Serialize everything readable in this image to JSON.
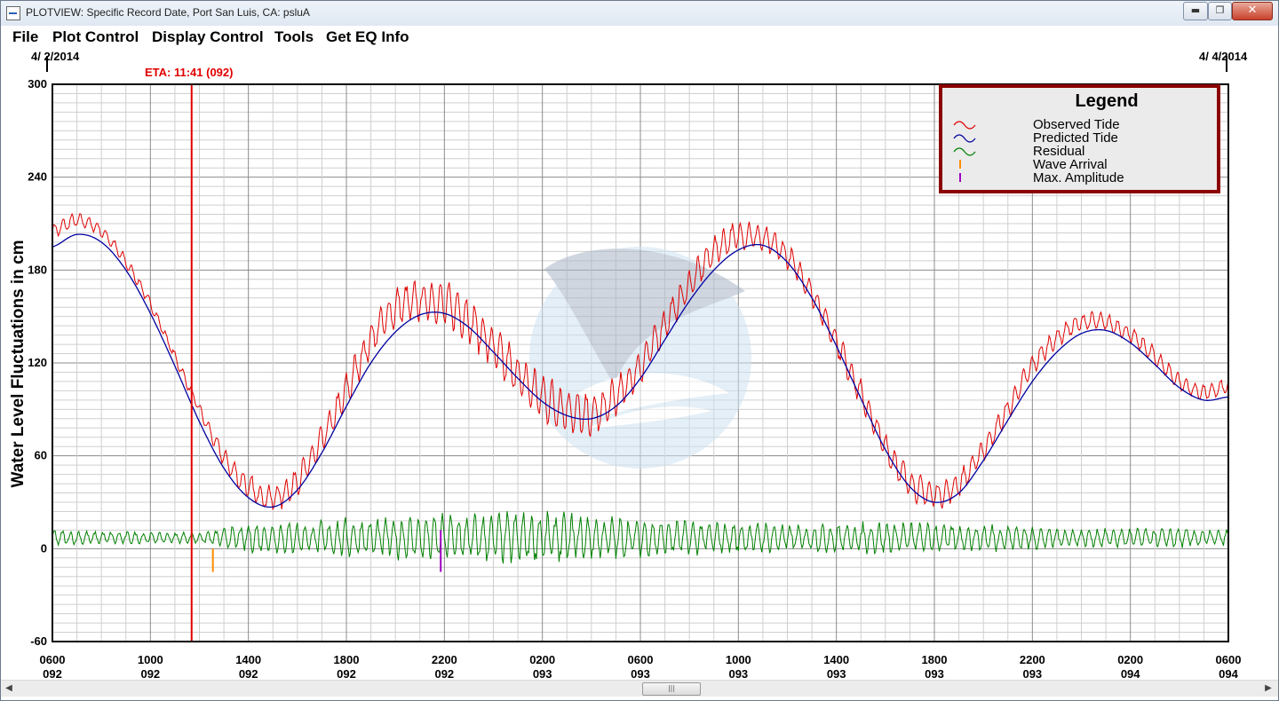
{
  "window": {
    "title": "PLOTVIEW: Specific Record Date, Port San Luis, CA: psluA",
    "minimize_label": "▬",
    "maximize_label": "❐",
    "close_label": "✕"
  },
  "menu": {
    "items": [
      "File",
      "Plot Control",
      "Display Control",
      "Tools",
      "Get EQ Info"
    ]
  },
  "plot": {
    "date_start": "4/ 2/2014",
    "date_end": "4/ 4/2014",
    "eta_label": "ETA: 11:41 (092)",
    "legend_title": "Legend",
    "watermark_icon": "noaa-bird-logo",
    "colors": {
      "observed": "#e00000",
      "predicted": "#0000a0",
      "residual": "#008000",
      "wave_arrival": "#ff8c00",
      "max_amplitude": "#a000c0",
      "eta_line": "#e00000",
      "legend_border": "#8b0000"
    }
  },
  "chart_data": {
    "type": "line",
    "title": "",
    "ylabel": "Water Level Fluctuations in cm",
    "xlabel": "",
    "ylim": [
      -60,
      300
    ],
    "yticks": [
      -60,
      0,
      60,
      120,
      180,
      240,
      300
    ],
    "xlim_hours": [
      0,
      48
    ],
    "xtick_labels": [
      [
        "0600",
        "092"
      ],
      [
        "1000",
        "092"
      ],
      [
        "1400",
        "092"
      ],
      [
        "1800",
        "092"
      ],
      [
        "2200",
        "092"
      ],
      [
        "0200",
        "093"
      ],
      [
        "0600",
        "093"
      ],
      [
        "1000",
        "093"
      ],
      [
        "1400",
        "093"
      ],
      [
        "1800",
        "093"
      ],
      [
        "2200",
        "093"
      ],
      [
        "0200",
        "094"
      ],
      [
        "0600",
        "094"
      ]
    ],
    "grid": true,
    "legend_position": "top-right",
    "legend": [
      "Observed Tide",
      "Predicted Tide",
      "Residual",
      "Wave Arrival",
      "Max. Amplitude"
    ],
    "series": [
      {
        "name": "Predicted Tide",
        "hours": [
          0,
          1,
          2,
          3,
          4,
          5,
          6,
          7,
          8,
          9,
          10,
          11,
          12,
          13,
          14,
          15,
          16,
          17,
          18,
          19,
          20,
          21,
          22,
          23,
          24,
          25,
          26,
          27,
          28,
          29,
          30,
          31,
          32,
          33,
          34,
          35,
          36,
          37,
          38,
          39,
          40,
          41,
          42,
          43,
          44,
          45,
          46,
          47,
          48
        ],
        "values": [
          195,
          203,
          198,
          180,
          152,
          118,
          82,
          52,
          33,
          27,
          38,
          62,
          92,
          120,
          140,
          151,
          152,
          143,
          127,
          110,
          95,
          86,
          84,
          92,
          110,
          135,
          160,
          180,
          193,
          196,
          185,
          162,
          131,
          97,
          64,
          40,
          30,
          36,
          57,
          83,
          108,
          127,
          139,
          141,
          133,
          119,
          104,
          96,
          98
        ]
      },
      {
        "name": "Observed Tide",
        "hours": [
          0,
          1,
          2,
          3,
          4,
          5,
          6,
          7,
          8,
          9,
          10,
          11,
          12,
          13,
          14,
          15,
          16,
          17,
          18,
          19,
          20,
          21,
          22,
          23,
          24,
          25,
          26,
          27,
          28,
          29,
          30,
          31,
          32,
          33,
          34,
          35,
          36,
          37,
          38,
          39,
          40,
          41,
          42,
          43,
          44,
          45,
          46,
          47,
          48
        ],
        "values": [
          205,
          212,
          205,
          185,
          158,
          124,
          90,
          59,
          40,
          33,
          44,
          70,
          102,
          135,
          155,
          160,
          158,
          148,
          130,
          112,
          98,
          90,
          86,
          98,
          118,
          145,
          170,
          192,
          202,
          200,
          189,
          165,
          134,
          100,
          66,
          43,
          35,
          42,
          64,
          90,
          118,
          136,
          146,
          146,
          138,
          124,
          108,
          101,
          105
        ]
      },
      {
        "name": "Residual",
        "hours": [
          0,
          1,
          2,
          3,
          4,
          5,
          6,
          7,
          8,
          9,
          10,
          11,
          12,
          13,
          14,
          15,
          16,
          17,
          18,
          19,
          20,
          21,
          22,
          23,
          24,
          25,
          26,
          27,
          28,
          29,
          30,
          31,
          32,
          33,
          34,
          35,
          36,
          37,
          38,
          39,
          40,
          41,
          42,
          43,
          44,
          45,
          46,
          47,
          48
        ],
        "amplitude": [
          8,
          7,
          6,
          6,
          5,
          5,
          6,
          9,
          13,
          14,
          15,
          16,
          18,
          18,
          20,
          20,
          22,
          23,
          23,
          24,
          24,
          23,
          22,
          20,
          18,
          17,
          16,
          15,
          15,
          14,
          13,
          13,
          14,
          15,
          15,
          15,
          14,
          13,
          13,
          12,
          11,
          10,
          9,
          9,
          9,
          10,
          9,
          8,
          8
        ],
        "baseline": 7
      }
    ],
    "markers": {
      "eta_hour": 5.683,
      "wave_arrival_hour": 6.55,
      "wave_arrival_value": -15,
      "max_amplitude_hour": 15.85,
      "max_amplitude_value": -15
    }
  }
}
